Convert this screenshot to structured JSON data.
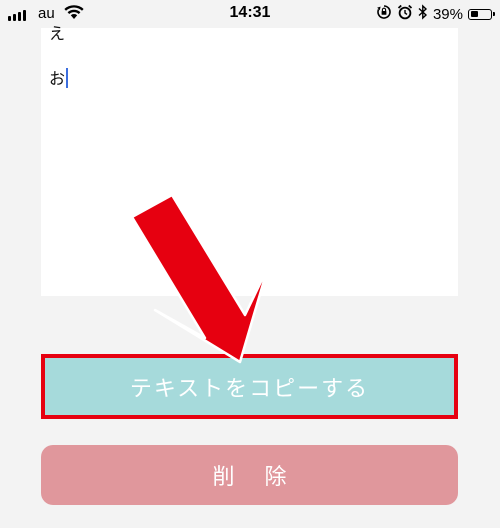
{
  "status_bar": {
    "carrier": "au",
    "time": "14:31",
    "battery_percent": "39%",
    "battery_level": 0.39,
    "icons": [
      "signal-icon",
      "wifi-icon",
      "orientation-lock-icon",
      "alarm-icon",
      "bluetooth-icon",
      "battery-icon"
    ]
  },
  "editor": {
    "lines": [
      "え",
      "お"
    ]
  },
  "buttons": {
    "copy_label": "テキストをコピーする",
    "delete_label": "削除"
  },
  "colors": {
    "copy_button": "#a6dadb",
    "copy_highlight_border": "#e60010",
    "delete_button": "#e0979c",
    "arrow": "#e60010",
    "caret": "#3c6ede"
  }
}
